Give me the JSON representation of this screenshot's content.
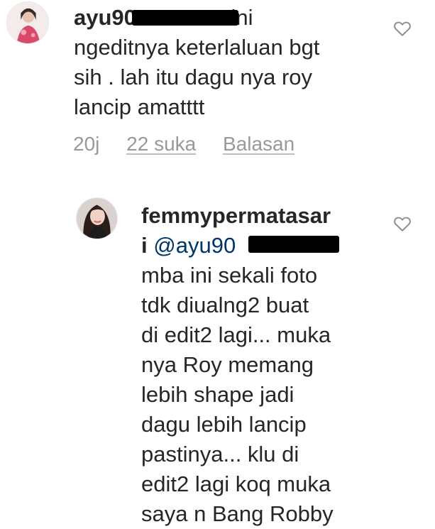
{
  "comment1": {
    "username": "ayu90",
    "text_first": "ini",
    "text_rest": "ngeditnya keterlaluan bgt\nsih . lah itu dagu nya  roy\nlancip amatttt",
    "time": "20j",
    "likes": "22 suka",
    "reply": "Balasan",
    "like_icon": "heart-outline-icon"
  },
  "comment2": {
    "username_line1": "femmypermatasar",
    "username_line2": "i",
    "mention": "@ayu90",
    "text": "mba ini sekali foto\ntdk diualng2 buat\ndi edit2 lagi... muka\nnya Roy memang\nlebih shape  jadi\ndagu lebih lancip\npastinya... klu di\nedit2 lagi koq muka\nsaya n Bang Robby",
    "like_icon": "heart-outline-icon"
  },
  "colors": {
    "text": "#262626",
    "meta": "#999999",
    "mention": "#003569",
    "background": "#ffffff"
  }
}
